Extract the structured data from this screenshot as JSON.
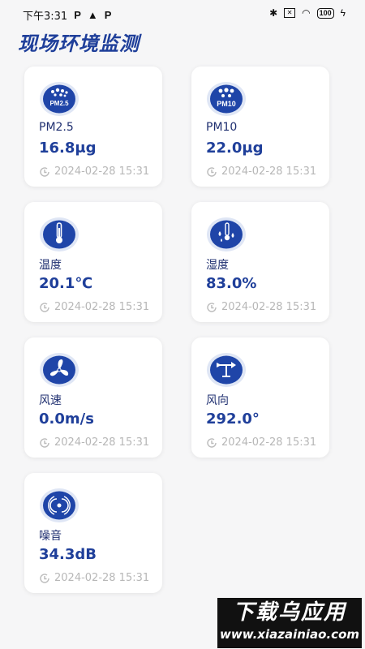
{
  "status_bar": {
    "time": "下午3:31",
    "left_icons": [
      "P",
      "▲",
      "P"
    ],
    "battery": "100"
  },
  "page": {
    "title": "现场环境监测"
  },
  "cards": [
    {
      "icon": "pm25-icon",
      "label": "PM2.5",
      "value": "16.8μg",
      "timestamp": "2024-02-28 15:31"
    },
    {
      "icon": "pm10-icon",
      "label": "PM10",
      "value": "22.0μg",
      "timestamp": "2024-02-28 15:31"
    },
    {
      "icon": "thermometer-icon",
      "label": "温度",
      "value": "20.1℃",
      "timestamp": "2024-02-28 15:31"
    },
    {
      "icon": "humidity-icon",
      "label": "湿度",
      "value": "83.0%",
      "timestamp": "2024-02-28 15:31"
    },
    {
      "icon": "fan-icon",
      "label": "风速",
      "value": "0.0m/s",
      "timestamp": "2024-02-28 15:31"
    },
    {
      "icon": "wind-vane-icon",
      "label": "风向",
      "value": "292.0°",
      "timestamp": "2024-02-28 15:31"
    },
    {
      "icon": "noise-icon",
      "label": "噪音",
      "value": "34.3dB",
      "timestamp": "2024-02-28 15:31"
    }
  ],
  "watermark": {
    "title": "下载乌应用",
    "url": "www.xiazainiao.com"
  },
  "colors": {
    "accent": "#1f3f9a",
    "icon_bg": "#1f45a8",
    "icon_ring": "#dfe6f5"
  }
}
